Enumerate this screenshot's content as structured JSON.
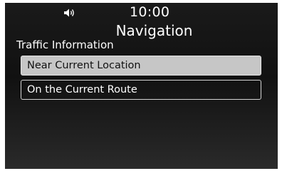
{
  "status": {
    "volume_icon": "speaker-icon",
    "time": "10:00"
  },
  "screen": {
    "title": "Navigation",
    "subtitle": "Traffic Information"
  },
  "menu": {
    "items": [
      {
        "label": "Near Current Location",
        "selected": true
      },
      {
        "label": "On the Current Route",
        "selected": false
      }
    ]
  },
  "colors": {
    "background": "#141414",
    "selected_item": "#c6c6c6",
    "text": "#ffffff"
  }
}
